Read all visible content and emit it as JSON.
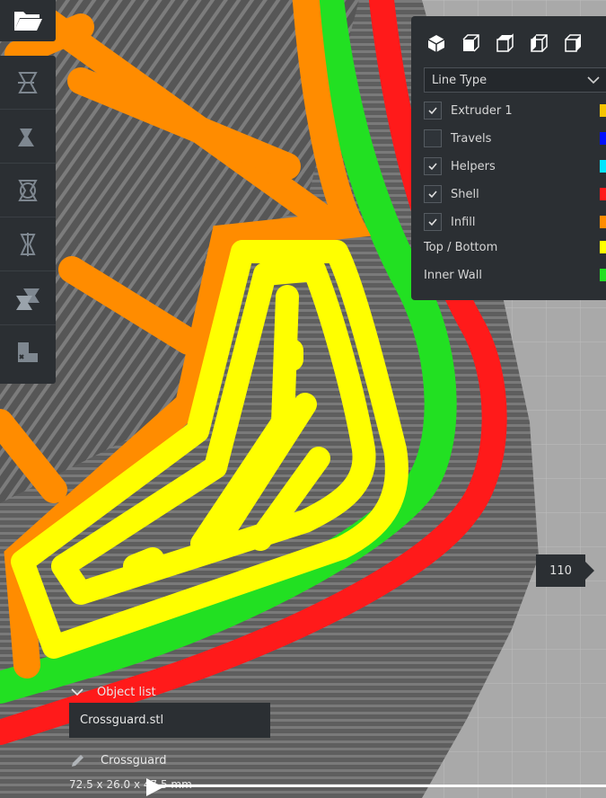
{
  "toolbar": {
    "open_icon": "folder-open-icon",
    "tools": [
      {
        "name": "move-tool",
        "icon": "move-icon"
      },
      {
        "name": "scale-tool",
        "icon": "scale-icon"
      },
      {
        "name": "rotate-tool",
        "icon": "rotate-icon"
      },
      {
        "name": "mirror-tool",
        "icon": "mirror-icon"
      },
      {
        "name": "per-model-settings-tool",
        "icon": "per-model-settings-icon"
      },
      {
        "name": "support-blocker-tool",
        "icon": "support-blocker-icon"
      }
    ]
  },
  "view_panel": {
    "views": [
      "3d-view-icon",
      "front-view-icon",
      "top-view-icon",
      "left-view-icon",
      "right-view-icon"
    ],
    "dropdown_value": "Line Type",
    "legend": [
      {
        "label": "Extruder 1",
        "checked": true,
        "color": "#f5c400"
      },
      {
        "label": "Travels",
        "checked": false,
        "color": "#0010ff"
      },
      {
        "label": "Helpers",
        "checked": true,
        "color": "#00e5ff"
      },
      {
        "label": "Shell",
        "checked": true,
        "color": "#ff1a1a"
      },
      {
        "label": "Infill",
        "checked": true,
        "color": "#ff8c00"
      },
      {
        "label": "Top / Bottom",
        "checked": null,
        "color": "#ffff00"
      },
      {
        "label": "Inner Wall",
        "checked": null,
        "color": "#22e022"
      }
    ]
  },
  "layer_slider": {
    "value": "110"
  },
  "object_list": {
    "header": "Object list",
    "items": [
      "Crossguard.stl"
    ],
    "object_name": "Crossguard",
    "dimensions": "72.5 x 26.0 x 47.5 mm"
  },
  "colors": {
    "panel_bg": "#2b2f33",
    "shell": "#ff1a1a",
    "inner_wall": "#22e022",
    "top_bottom": "#ffff00",
    "infill": "#ff8c00",
    "layers_gray": "#6b6b6b"
  }
}
